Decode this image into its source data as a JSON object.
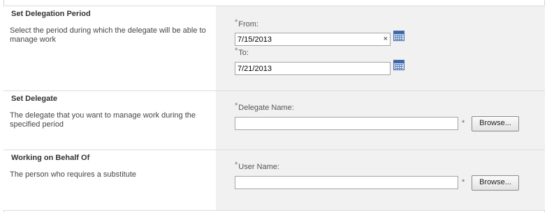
{
  "period": {
    "title": "Set Delegation Period",
    "description": "Select the period during which the delegate will be able to manage work",
    "from_label": "From:",
    "from_value": "7/15/2013",
    "clear_glyph": "×",
    "to_label": "To:",
    "to_value": "7/21/2013",
    "calendar_icon": "calendar-icon"
  },
  "delegate": {
    "title": "Set Delegate",
    "description": "The delegate that you want to manage work during the specified period",
    "field_label": "Delegate Name:",
    "field_value": "",
    "browse_label": "Browse..."
  },
  "behalf": {
    "title": "Working on Behalf Of",
    "description": "The person who requires a substitute",
    "field_label": "User Name:",
    "field_value": "",
    "browse_label": "Browse..."
  },
  "required_marker": "*"
}
